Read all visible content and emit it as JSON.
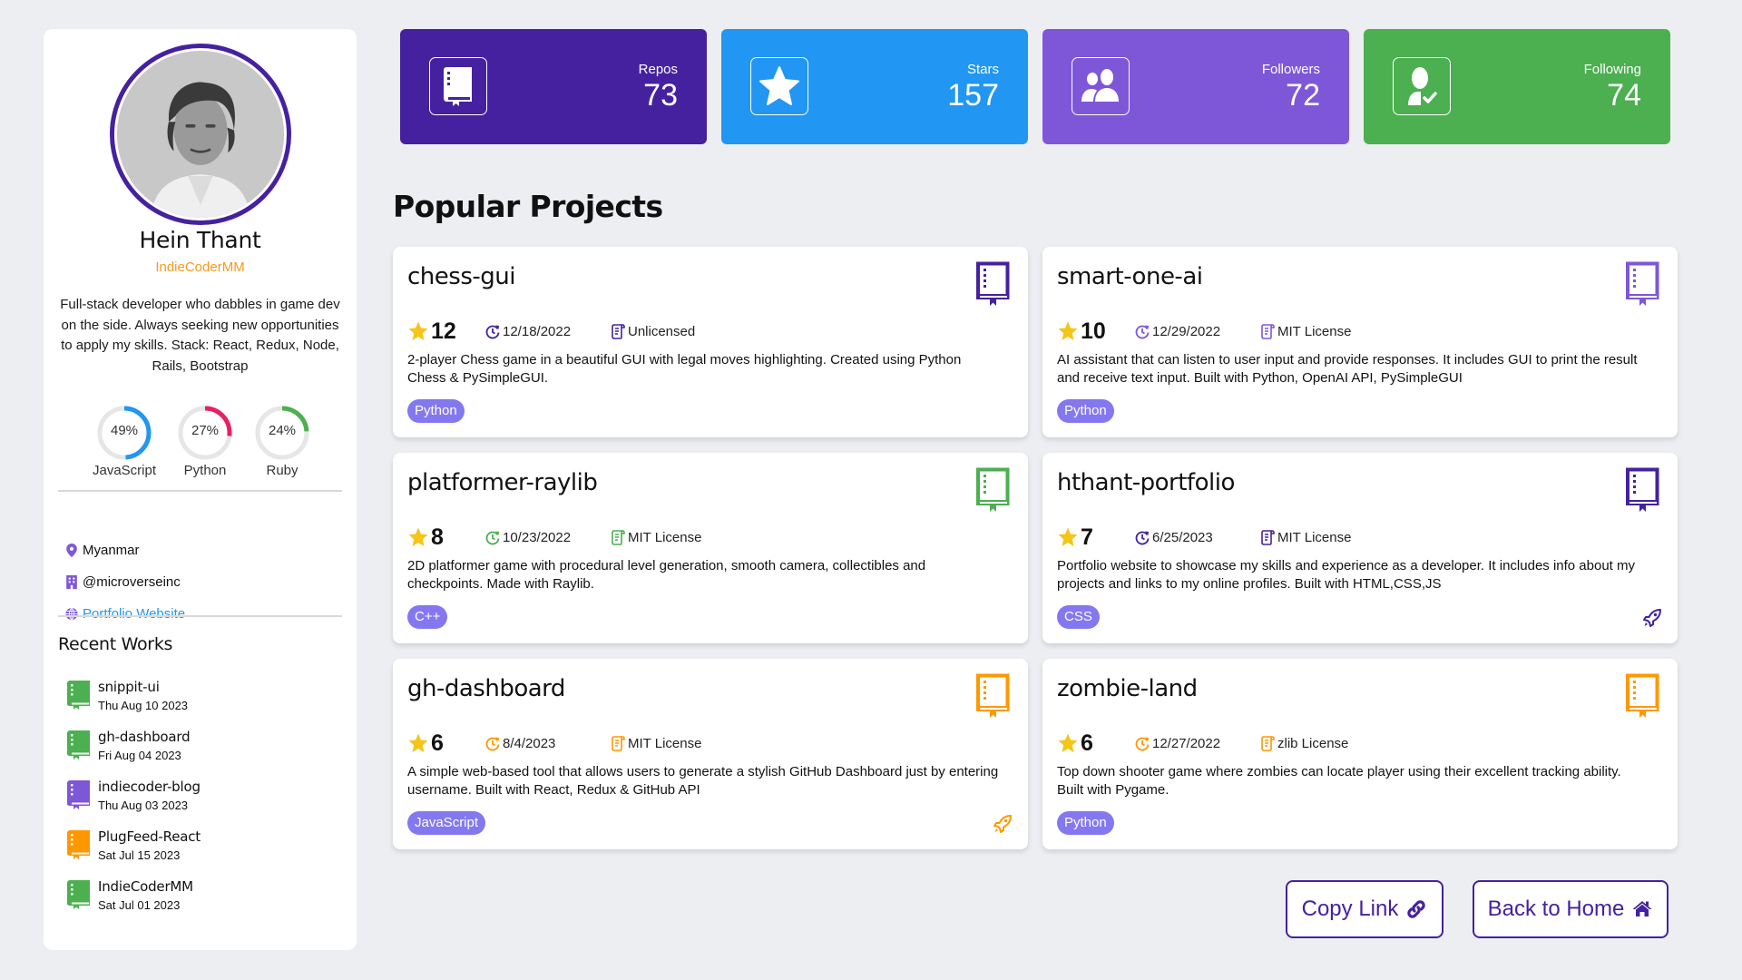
{
  "profile": {
    "name": "Hein Thant",
    "handle": "IndieCoderMM",
    "bio": "Full-stack developer who dabbles in game dev on the side. Always seeking new opportunities to apply my skills. Stack: React, Redux, Node, Rails, Bootstrap",
    "border_color": "#4521a0",
    "languages": [
      {
        "name": "JavaScript",
        "percent": 49,
        "percent_label": "49%",
        "color": "#2196f3"
      },
      {
        "name": "Python",
        "percent": 27,
        "percent_label": "27%",
        "color": "#e91e63"
      },
      {
        "name": "Ruby",
        "percent": 24,
        "percent_label": "24%",
        "color": "#4caf50"
      }
    ],
    "location": "Myanmar",
    "company": "@microverseinc",
    "website_label": "Portfolio Website",
    "icons": {
      "location": "map-pin-icon",
      "company": "building-icon",
      "website": "globe-icon"
    }
  },
  "recent_works": {
    "title": "Recent Works",
    "items": [
      {
        "name": "snippit-ui",
        "date": "Thu Aug 10 2023",
        "color": "#4caf50"
      },
      {
        "name": "gh-dashboard",
        "date": "Fri Aug 04 2023",
        "color": "#4caf50"
      },
      {
        "name": "indiecoder-blog",
        "date": "Thu Aug 03 2023",
        "color": "#7e57d8"
      },
      {
        "name": "PlugFeed-React",
        "date": "Sat Jul 15 2023",
        "color": "#ff9800"
      },
      {
        "name": "IndieCoderMM",
        "date": "Sat Jul 01 2023",
        "color": "#4caf50"
      }
    ]
  },
  "stats": [
    {
      "label": "Repos",
      "value": "73",
      "icon": "repo-book-icon",
      "color": "#4521a0"
    },
    {
      "label": "Stars",
      "value": "157",
      "icon": "star-icon",
      "color": "#2196f3"
    },
    {
      "label": "Followers",
      "value": "72",
      "icon": "users-icon",
      "color": "#7e57d8"
    },
    {
      "label": "Following",
      "value": "74",
      "icon": "user-check-icon",
      "color": "#4caf50"
    }
  ],
  "projects": {
    "title": "Popular Projects",
    "items": [
      {
        "name": "chess-gui",
        "stars": "12",
        "date": "12/18/2022",
        "license": "Unlicensed",
        "description": "2-player Chess game in a beautiful GUI with legal moves highlighting. Created using Python Chess & PySimpleGUI.",
        "tag": "Python",
        "accent": "#4521a0",
        "has_deploy": false
      },
      {
        "name": "smart-one-ai",
        "stars": "10",
        "date": "12/29/2022",
        "license": "MIT License",
        "description": "AI assistant that can listen to user input and provide responses. It includes GUI to print the result and receive text input. Built with Python, OpenAI API, PySimpleGUI",
        "tag": "Python",
        "accent": "#7e57d8",
        "has_deploy": false
      },
      {
        "name": "platformer-raylib",
        "stars": "8",
        "date": "10/23/2022",
        "license": "MIT License",
        "description": "2D platformer game with procedural level generation, smooth camera, collectibles and checkpoints. Made with Raylib.",
        "tag": "C++",
        "accent": "#4caf50",
        "has_deploy": false
      },
      {
        "name": "hthant-portfolio",
        "stars": "7",
        "date": "6/25/2023",
        "license": "MIT License",
        "description": "Portfolio website to showcase my skills and experience as a developer. It includes info about my projects and links to my online profiles. Built with HTML,CSS,JS",
        "tag": "CSS",
        "accent": "#4521a0",
        "has_deploy": true
      },
      {
        "name": "gh-dashboard",
        "stars": "6",
        "date": "8/4/2023",
        "license": "MIT License",
        "description": "A simple web-based tool that allows users to generate a stylish GitHub Dashboard just by entering username. Built with React, Redux & GitHub API",
        "tag": "JavaScript",
        "accent": "#ff9800",
        "has_deploy": true
      },
      {
        "name": "zombie-land",
        "stars": "6",
        "date": "12/27/2022",
        "license": "zlib License",
        "description": "Top down shooter game where zombies can locate player using their excellent tracking ability. Built with Pygame.",
        "tag": "Python",
        "accent": "#ff9800",
        "has_deploy": false
      }
    ]
  },
  "actions": {
    "copy_link": "Copy Link",
    "back_home": "Back to Home"
  },
  "colors": {
    "star": "#f5c518",
    "tag_bg": "#8478f0",
    "link": "#2196f3",
    "background": "#eceef1"
  }
}
